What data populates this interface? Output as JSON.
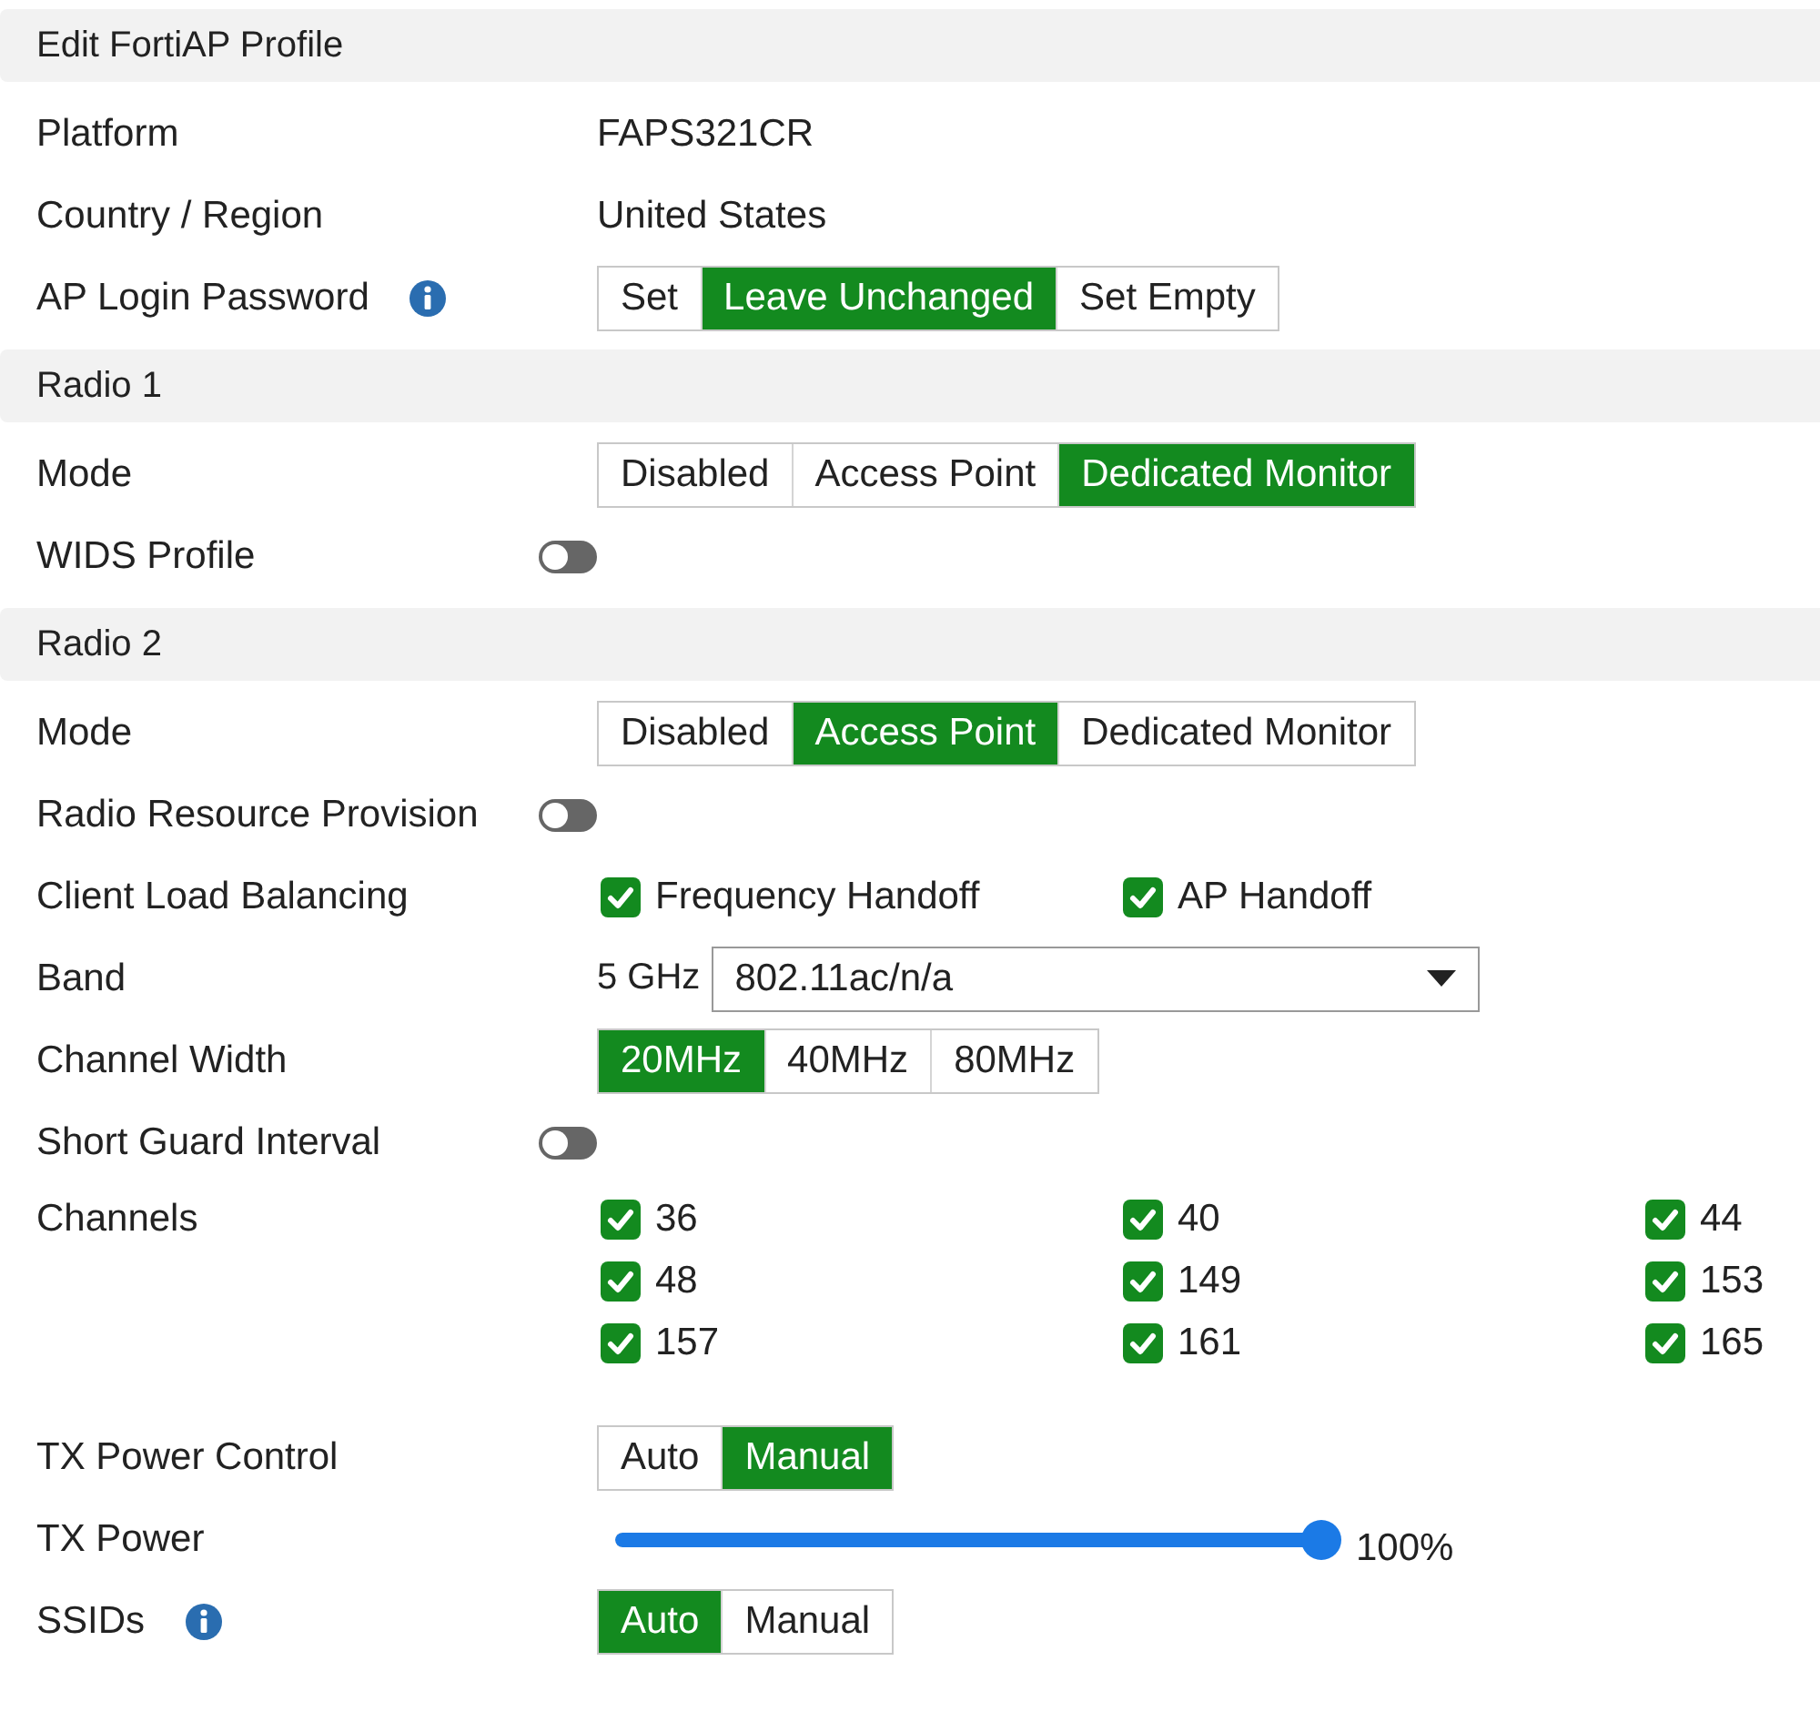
{
  "sections": [
    {
      "title": "Edit FortiAP Profile",
      "rows": [
        {
          "kind": "text",
          "label": "Platform",
          "value": "FAPS321CR"
        },
        {
          "kind": "text",
          "label": "Country / Region",
          "value": "United States"
        },
        {
          "kind": "segmented",
          "label": "AP Login Password",
          "info": true,
          "options": [
            {
              "label": "Set",
              "selected": false
            },
            {
              "label": "Leave Unchanged",
              "selected": true
            },
            {
              "label": "Set Empty",
              "selected": false
            }
          ]
        }
      ]
    },
    {
      "title": "Radio 1",
      "rows": [
        {
          "kind": "segmented",
          "label": "Mode",
          "options": [
            {
              "label": "Disabled",
              "selected": false
            },
            {
              "label": "Access Point",
              "selected": false
            },
            {
              "label": "Dedicated Monitor",
              "selected": true
            }
          ]
        },
        {
          "kind": "toggle",
          "label": "WIDS Profile",
          "on": false
        }
      ]
    },
    {
      "title": "Radio 2",
      "rows": [
        {
          "kind": "segmented",
          "label": "Mode",
          "options": [
            {
              "label": "Disabled",
              "selected": false
            },
            {
              "label": "Access Point",
              "selected": true
            },
            {
              "label": "Dedicated Monitor",
              "selected": false
            }
          ]
        },
        {
          "kind": "toggle",
          "label": "Radio Resource Provision",
          "on": false
        },
        {
          "kind": "checkboxes",
          "label": "Client Load Balancing",
          "options": [
            {
              "label": "Frequency Handoff",
              "checked": true
            },
            {
              "label": "AP Handoff",
              "checked": true
            }
          ]
        },
        {
          "kind": "select",
          "label": "Band",
          "prefix": "5 GHz",
          "value": "802.11ac/n/a"
        },
        {
          "kind": "segmented",
          "label": "Channel Width",
          "options": [
            {
              "label": "20MHz",
              "selected": true
            },
            {
              "label": "40MHz",
              "selected": false
            },
            {
              "label": "80MHz",
              "selected": false
            }
          ]
        },
        {
          "kind": "toggle",
          "label": "Short Guard Interval",
          "on": false
        },
        {
          "kind": "channels",
          "label": "Channels",
          "options": [
            {
              "label": "36",
              "checked": true
            },
            {
              "label": "40",
              "checked": true
            },
            {
              "label": "44",
              "checked": true
            },
            {
              "label": "48",
              "checked": true
            },
            {
              "label": "149",
              "checked": true
            },
            {
              "label": "153",
              "checked": true
            },
            {
              "label": "157",
              "checked": true
            },
            {
              "label": "161",
              "checked": true
            },
            {
              "label": "165",
              "checked": true
            }
          ]
        },
        {
          "kind": "segmented",
          "label": "TX Power Control",
          "options": [
            {
              "label": "Auto",
              "selected": false
            },
            {
              "label": "Manual",
              "selected": true
            }
          ]
        },
        {
          "kind": "slider",
          "label": "TX Power",
          "level": 1,
          "reading": "100%"
        },
        {
          "kind": "segmented",
          "label": "SSIDs",
          "info": true,
          "options": [
            {
              "label": "Auto",
              "selected": true
            },
            {
              "label": "Manual",
              "selected": false
            }
          ]
        }
      ]
    }
  ]
}
